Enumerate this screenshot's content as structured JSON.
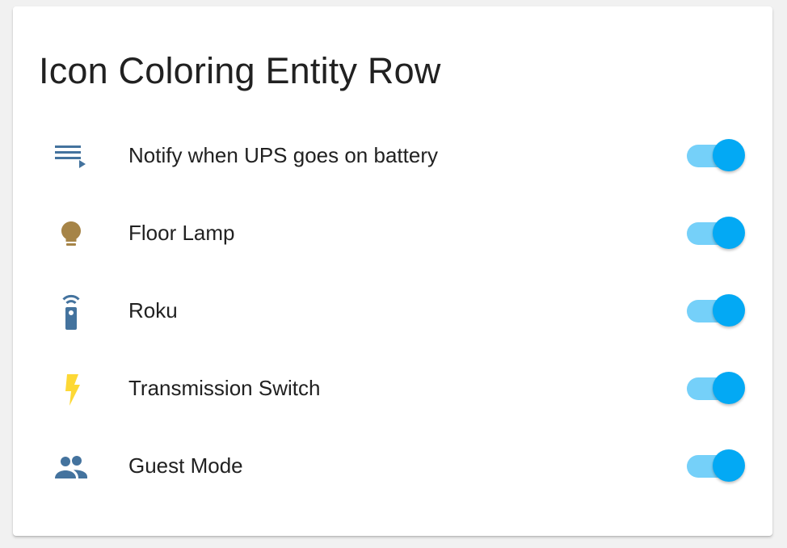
{
  "card": {
    "title": "Icon Coloring Entity Row"
  },
  "accent_color": "#03a9f4",
  "rows": [
    {
      "label": "Notify when UPS goes on battery",
      "icon": "playlist-play-icon",
      "icon_color": "#44739e",
      "state": "on"
    },
    {
      "label": "Floor Lamp",
      "icon": "lightbulb-icon",
      "icon_color": "#a68447",
      "state": "on"
    },
    {
      "label": "Roku",
      "icon": "remote-icon",
      "icon_color": "#44739e",
      "state": "on"
    },
    {
      "label": "Transmission Switch",
      "icon": "flash-icon",
      "icon_color": "#fdd835",
      "state": "on"
    },
    {
      "label": "Guest Mode",
      "icon": "account-multiple-icon",
      "icon_color": "#44739e",
      "state": "on"
    }
  ]
}
